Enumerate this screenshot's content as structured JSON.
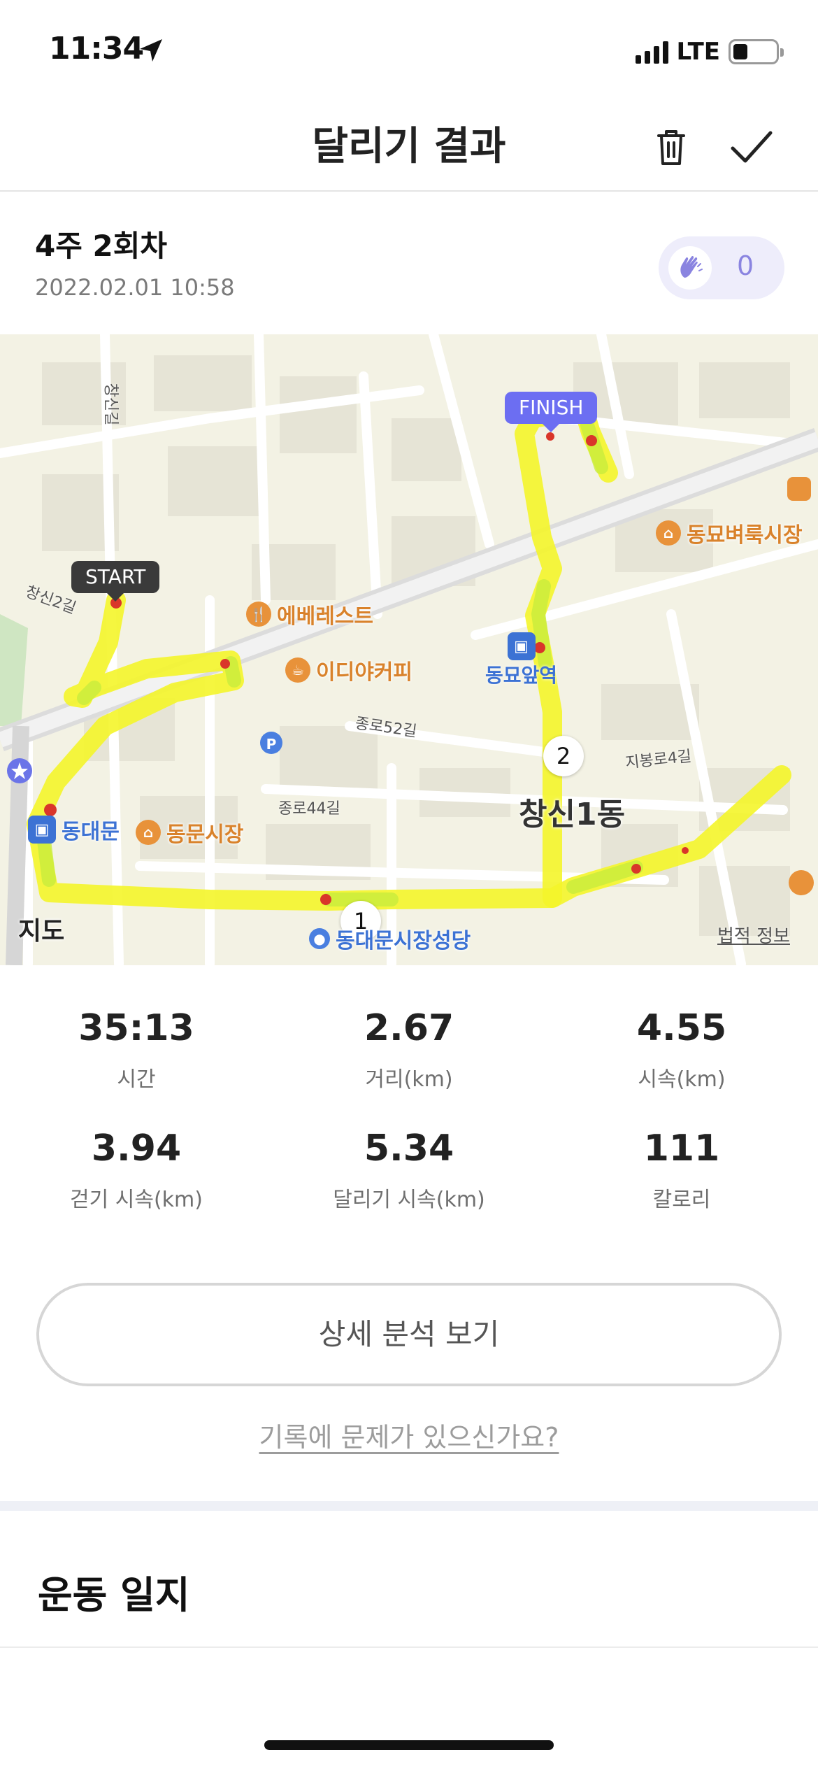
{
  "status_bar": {
    "time": "11:34",
    "network": "LTE"
  },
  "header": {
    "title": "달리기 결과",
    "delete_icon": "trash-icon",
    "confirm_icon": "checkmark-icon"
  },
  "session": {
    "title": "4주 2회차",
    "datetime": "2022.02.01 10:58",
    "claps_icon": "clapping-hands-icon",
    "claps_count": "0"
  },
  "map": {
    "start_label": "START",
    "finish_label": "FINISH",
    "km_markers": [
      "1",
      "2"
    ],
    "pois": [
      {
        "name": "에베레스트",
        "icon": "restaurant-icon"
      },
      {
        "name": "이디야커피",
        "icon": "cafe-icon"
      },
      {
        "name": "동묘벼룩시장",
        "icon": "market-icon"
      },
      {
        "name": "동문시장",
        "icon": "market-icon"
      }
    ],
    "streets": [
      "창신2길",
      "창신길",
      "종로52길",
      "종로44길",
      "지봉로4길"
    ],
    "subway_station": "동묘앞역",
    "district": "창신1동",
    "partial_labels": [
      "동대문",
      "동대문시장성당"
    ],
    "maps_brand": "지도",
    "legal_label": "법적 정보",
    "route_colors": {
      "fast": "#f4f52a",
      "medium": "#c8ec3c",
      "slow": "#d9362a"
    }
  },
  "stats": [
    {
      "value": "35:13",
      "label": "시간"
    },
    {
      "value": "2.67",
      "label": "거리(km)"
    },
    {
      "value": "4.55",
      "label": "시속(km)"
    },
    {
      "value": "3.94",
      "label": "걷기 시속(km)"
    },
    {
      "value": "5.34",
      "label": "달리기 시속(km)"
    },
    {
      "value": "111",
      "label": "칼로리"
    }
  ],
  "actions": {
    "detail_button": "상세 분석 보기",
    "issue_link": "기록에 문제가 있으신가요?"
  },
  "journal": {
    "title": "운동 일지"
  },
  "colors": {
    "accent": "#6c6ef2",
    "clap_bg": "#eeedfb"
  }
}
